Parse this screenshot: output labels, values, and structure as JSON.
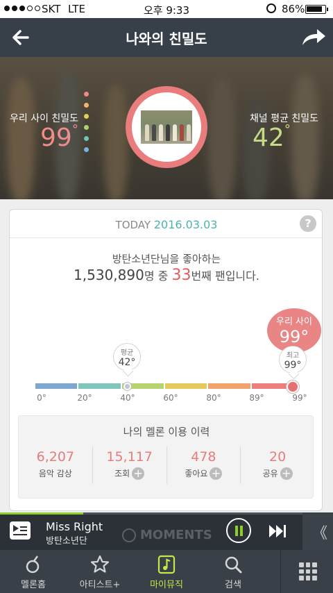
{
  "status_bar": {
    "carrier": "SKT",
    "network": "LTE",
    "time": "오후 9:33",
    "battery_percent": "86%",
    "battery_level": 0.86
  },
  "header": {
    "title": "나와의 친밀도"
  },
  "hero": {
    "my_label": "우리 사이 친밀도",
    "my_value": "99",
    "channel_label": "채널 평균 친밀도",
    "channel_value": "42",
    "dot_colors": [
      "#ef8a8a",
      "#f2b36a",
      "#d9d35a",
      "#a8d472",
      "#6ec7b6",
      "#7ab0e3"
    ]
  },
  "card": {
    "today_label": "TODAY",
    "date": "2016.03.03",
    "help_icon": "?",
    "line1": "방탄소년단님을 좋아하는",
    "count": "1,530,890",
    "line2_mid": "명 중",
    "rank": "33",
    "line2_end": "번째 팬입니다.",
    "avg_label": "평균",
    "avg_value": "42",
    "my_label": "우리 사이",
    "my_value": "99",
    "max_label": "최고",
    "max_value": "99",
    "ticks": [
      "0°",
      "20°",
      "40°",
      "60°",
      "80°",
      "89°",
      "99°"
    ],
    "bar_colors": [
      "#7ea7cf",
      "#7fc7bd",
      "#b7d36f",
      "#e4c95c",
      "#f1a36d",
      "#ec7e7e"
    ],
    "history_title": "나의 멜론 이용 이력",
    "stats": [
      {
        "value": "6,207",
        "label": "음악 감상",
        "has_plus": false
      },
      {
        "value": "15,117",
        "label": "조회",
        "has_plus": true
      },
      {
        "value": "478",
        "label": "좋아요",
        "has_plus": true
      },
      {
        "value": "20",
        "label": "공유",
        "has_plus": true
      }
    ]
  },
  "player": {
    "song": "Miss Right",
    "artist": "방탄소년단",
    "moments": "MOMENTS",
    "progress": 0.25,
    "expand_icon": "《"
  },
  "nav": {
    "items": [
      {
        "label": "멜론홈",
        "icon": "melon-icon",
        "active": false
      },
      {
        "label": "아티스트+",
        "icon": "star-icon",
        "active": false
      },
      {
        "label": "마이뮤직",
        "icon": "music-note-icon",
        "active": true
      },
      {
        "label": "검색",
        "icon": "search-icon",
        "active": false
      }
    ],
    "menu_icon": "grid-menu-icon"
  },
  "colors": {
    "accent_red": "#e87b7b",
    "accent_green": "#8dcf2a",
    "header_bg": "#373f48",
    "date_teal": "#4bb3ad"
  }
}
